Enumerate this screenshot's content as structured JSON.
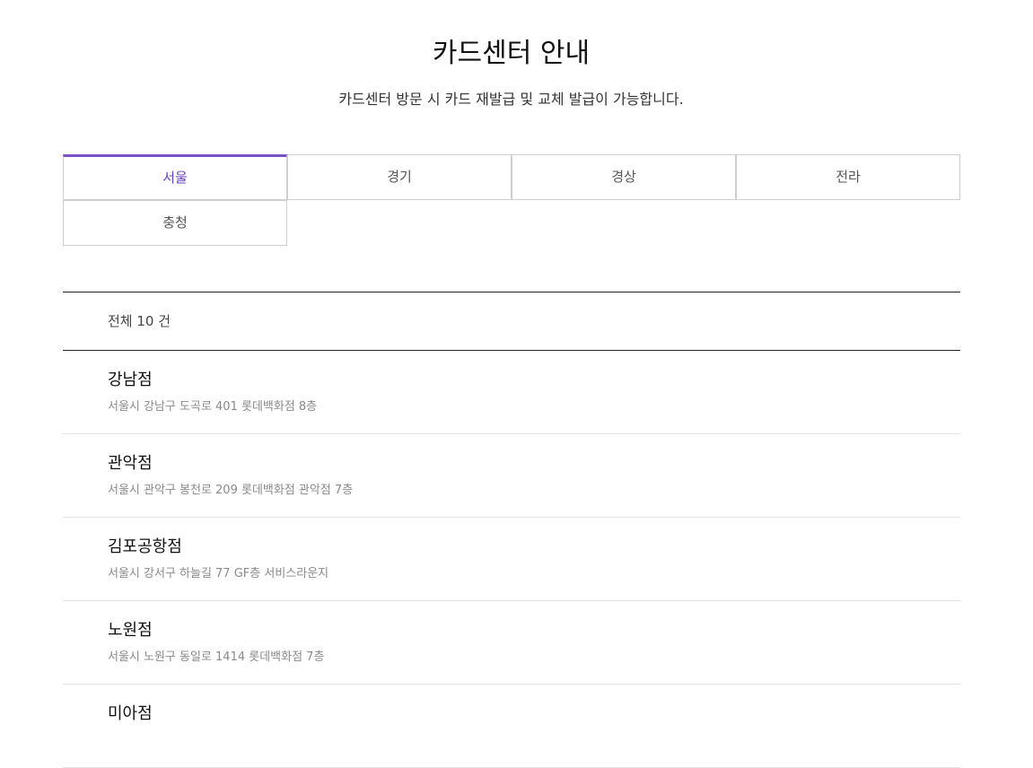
{
  "header": {
    "title": "카드센터 안내",
    "subtitle": "카드센터 방문 시 카드 재발급 및 교체 발급이 가능합니다."
  },
  "tabs": [
    {
      "label": "서울",
      "active": true
    },
    {
      "label": "경기",
      "active": false
    },
    {
      "label": "경상",
      "active": false
    },
    {
      "label": "전라",
      "active": false
    },
    {
      "label": "충청",
      "active": false
    }
  ],
  "list": {
    "count_text": "전체 10 건",
    "stores": [
      {
        "name": "강남점",
        "address": "서울시 강남구 도곡로 401 롯데백화점 8층"
      },
      {
        "name": "관악점",
        "address": "서울시 관악구 봉천로 209 롯데백화점 관악점 7층"
      },
      {
        "name": "김포공항점",
        "address": "서울시 강서구 하늘길 77 GF층 서비스라운지"
      },
      {
        "name": "노원점",
        "address": "서울시 노원구 동일로 1414 롯데백화점 7층"
      },
      {
        "name": "미아점",
        "address": ""
      }
    ]
  },
  "colors": {
    "accent": "#7b52c6",
    "divider": "#222222",
    "row_border": "#e4e4e4"
  }
}
